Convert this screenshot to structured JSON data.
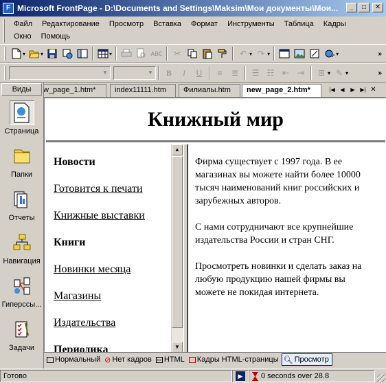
{
  "window": {
    "title": "Microsoft FrontPage - D:\\Documents and Settings\\Maksim\\Мои документы\\Мои..."
  },
  "menu": {
    "row1": [
      "Файл",
      "Редактирование",
      "Просмотр",
      "Вставка",
      "Формат",
      "Инструменты",
      "Таблица",
      "Кадры"
    ],
    "row2": [
      "Окно",
      "Помощь"
    ]
  },
  "views": {
    "header": "Виды",
    "items": [
      {
        "label": "Страница",
        "icon": "page-view-icon",
        "active": true
      },
      {
        "label": "Папки",
        "icon": "folder-icon",
        "active": false
      },
      {
        "label": "Отчеты",
        "icon": "reports-icon",
        "active": false
      },
      {
        "label": "Навигация",
        "icon": "navigation-icon",
        "active": false
      },
      {
        "label": "Гиперссы...",
        "icon": "hyperlinks-icon",
        "active": false
      },
      {
        "label": "Задачи",
        "icon": "tasks-icon",
        "active": false
      }
    ]
  },
  "tabs": [
    {
      "label": "w_page_1.htm*"
    },
    {
      "label": "index11111.htm"
    },
    {
      "label": "Филиалы.htm"
    },
    {
      "label": "new_page_2.htm*",
      "active": true
    }
  ],
  "page": {
    "banner": "Книжный мир",
    "nav": [
      {
        "label": "Новости",
        "style": "bold"
      },
      {
        "label": "Готовится к печати",
        "style": "link"
      },
      {
        "label": "Книжные выставки",
        "style": "link"
      },
      {
        "label": "Книги",
        "style": "bold"
      },
      {
        "label": "Новинки месяца",
        "style": "link"
      },
      {
        "label": "Магазины",
        "style": "link"
      },
      {
        "label": "Издательства",
        "style": "link"
      },
      {
        "label": "Периодика",
        "style": "bold"
      }
    ],
    "paragraphs": [
      "Фирма существует с 1997 года. В ее магазинах вы можете найти более 10000 тысяч наименований книг российских и зарубежных авторов.",
      "С нами сотрудничают все крупнейшие издательства России и стран СНГ.",
      "Просмотреть новинки и сделать заказ на любую продукцию нашей фирмы вы можете не покидая интернета."
    ]
  },
  "view_tabs": [
    {
      "label": "Нормальный",
      "icon": "normal-view-icon"
    },
    {
      "label": "Нет кадров",
      "icon": "no-frames-icon"
    },
    {
      "label": "HTML",
      "icon": "html-view-icon"
    },
    {
      "label": "Кадры HTML-страницы",
      "icon": "frames-html-icon"
    },
    {
      "label": "Просмотр",
      "icon": "preview-icon",
      "active": true
    }
  ],
  "status": {
    "text": "Готово",
    "timing": "0 seconds over 28.8"
  },
  "colors": {
    "title_start": "#0a246a",
    "title_end": "#a6caf0",
    "face": "#d4d0c8"
  }
}
